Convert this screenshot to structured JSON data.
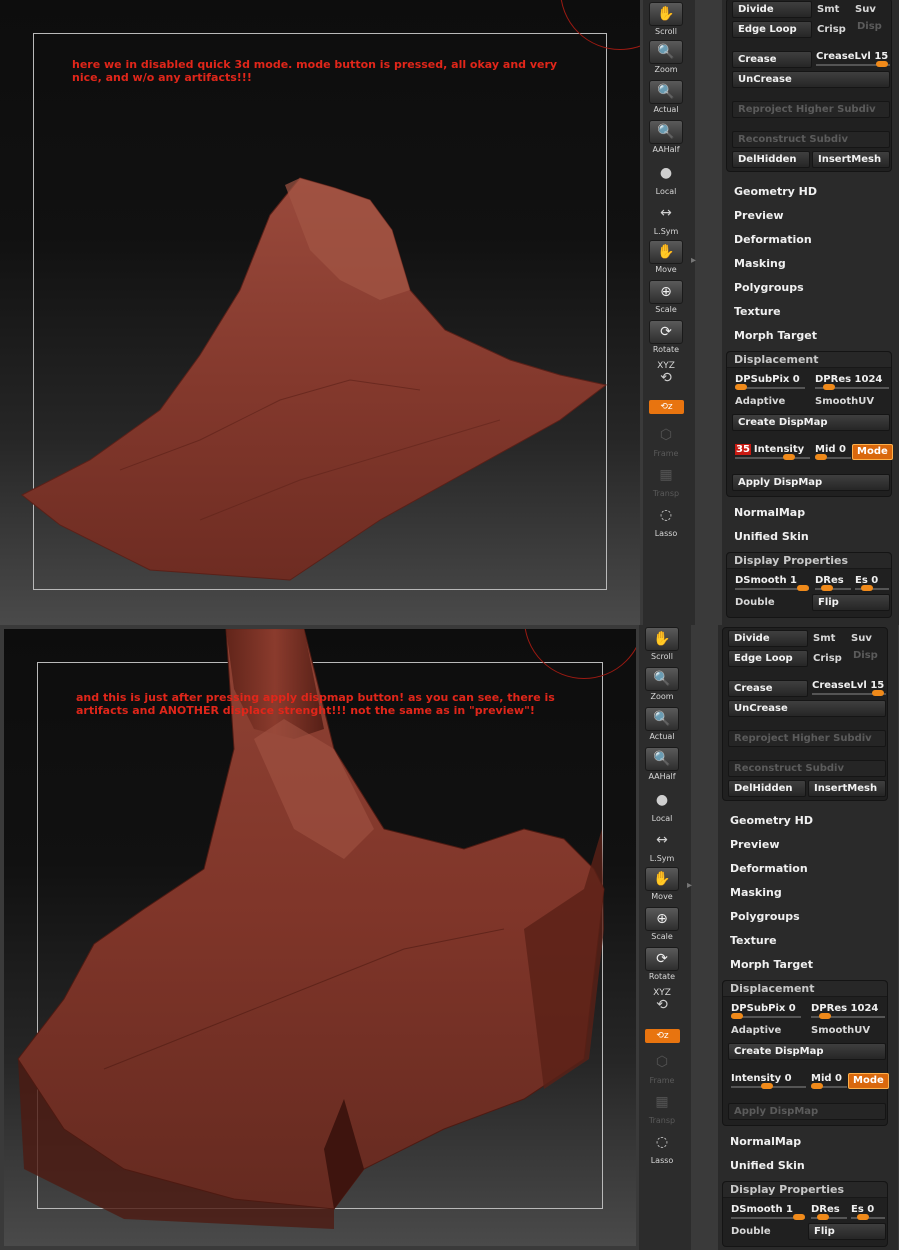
{
  "colors": {
    "accent": "#e8740f",
    "note_text": "#e0261a",
    "mesh": "#8a3c30"
  },
  "top": {
    "note": "here we in disabled quick 3d mode. mode button is pressed, all okay and very nice, and w/o any artifacts!!!",
    "geometry": {
      "divide": "Divide",
      "smt": "Smt",
      "suv": "Suv",
      "edge_loop": "Edge Loop",
      "crisp": "Crisp",
      "disp": "Disp",
      "crease": "Crease",
      "creaselvl": "CreaseLvl 15",
      "uncrease": "UnCrease",
      "reproject": "Reproject Higher Subdiv",
      "reconstruct": "Reconstruct Subdiv",
      "delhidden": "DelHidden",
      "insertmesh": "InsertMesh"
    },
    "menus": [
      "Geometry HD",
      "Preview",
      "Deformation",
      "Masking",
      "Polygroups",
      "Texture",
      "Morph Target"
    ],
    "displacement": {
      "title": "Displacement",
      "dpsubpix": "DPSubPix 0",
      "dpres": "DPRes 1024",
      "adaptive": "Adaptive",
      "smoothuv": "SmoothUV",
      "create": "Create DispMap",
      "intensity_badge": "35",
      "intensity": "Intensity",
      "mid": "Mid 0",
      "mode": "Mode",
      "apply": "Apply DispMap"
    },
    "menus2": [
      "NormalMap",
      "Unified Skin"
    ],
    "display": {
      "title": "Display Properties",
      "dsmooth": "DSmooth 1",
      "dres": "DRes",
      "es": "Es 0",
      "double": "Double",
      "flip": "Flip"
    }
  },
  "bottom": {
    "note": "and this is just after pressing apply dispmap button! as you can see, there is artifacts and ANOTHER displace strenght!!! not the same as in \"preview\"!",
    "geometry": {
      "divide": "Divide",
      "smt": "Smt",
      "suv": "Suv",
      "edge_loop": "Edge Loop",
      "crisp": "Crisp",
      "disp": "Disp",
      "crease": "Crease",
      "creaselvl": "CreaseLvl 15",
      "uncrease": "UnCrease",
      "reproject": "Reproject Higher Subdiv",
      "reconstruct": "Reconstruct Subdiv",
      "delhidden": "DelHidden",
      "insertmesh": "InsertMesh"
    },
    "menus": [
      "Geometry HD",
      "Preview",
      "Deformation",
      "Masking",
      "Polygroups",
      "Texture",
      "Morph Target"
    ],
    "displacement": {
      "title": "Displacement",
      "dpsubpix": "DPSubPix 0",
      "dpres": "DPRes 1024",
      "adaptive": "Adaptive",
      "smoothuv": "SmoothUV",
      "create": "Create DispMap",
      "intensity": "Intensity 0",
      "mid": "Mid 0",
      "mode": "Mode",
      "apply": "Apply DispMap"
    },
    "menus2": [
      "NormalMap",
      "Unified Skin"
    ],
    "display": {
      "title": "Display Properties",
      "dsmooth": "DSmooth 1",
      "dres": "DRes",
      "es": "Es 0",
      "double": "Double",
      "flip": "Flip"
    }
  },
  "toolbar": {
    "scroll": "Scroll",
    "zoom": "Zoom",
    "actual": "Actual",
    "aahalf": "AAHalf",
    "local": "Local",
    "lsym": "L.Sym",
    "move": "Move",
    "scale": "Scale",
    "rotate": "Rotate",
    "xyz": "XYZ",
    "frame": "Frame",
    "transp": "Transp",
    "lasso": "Lasso"
  }
}
